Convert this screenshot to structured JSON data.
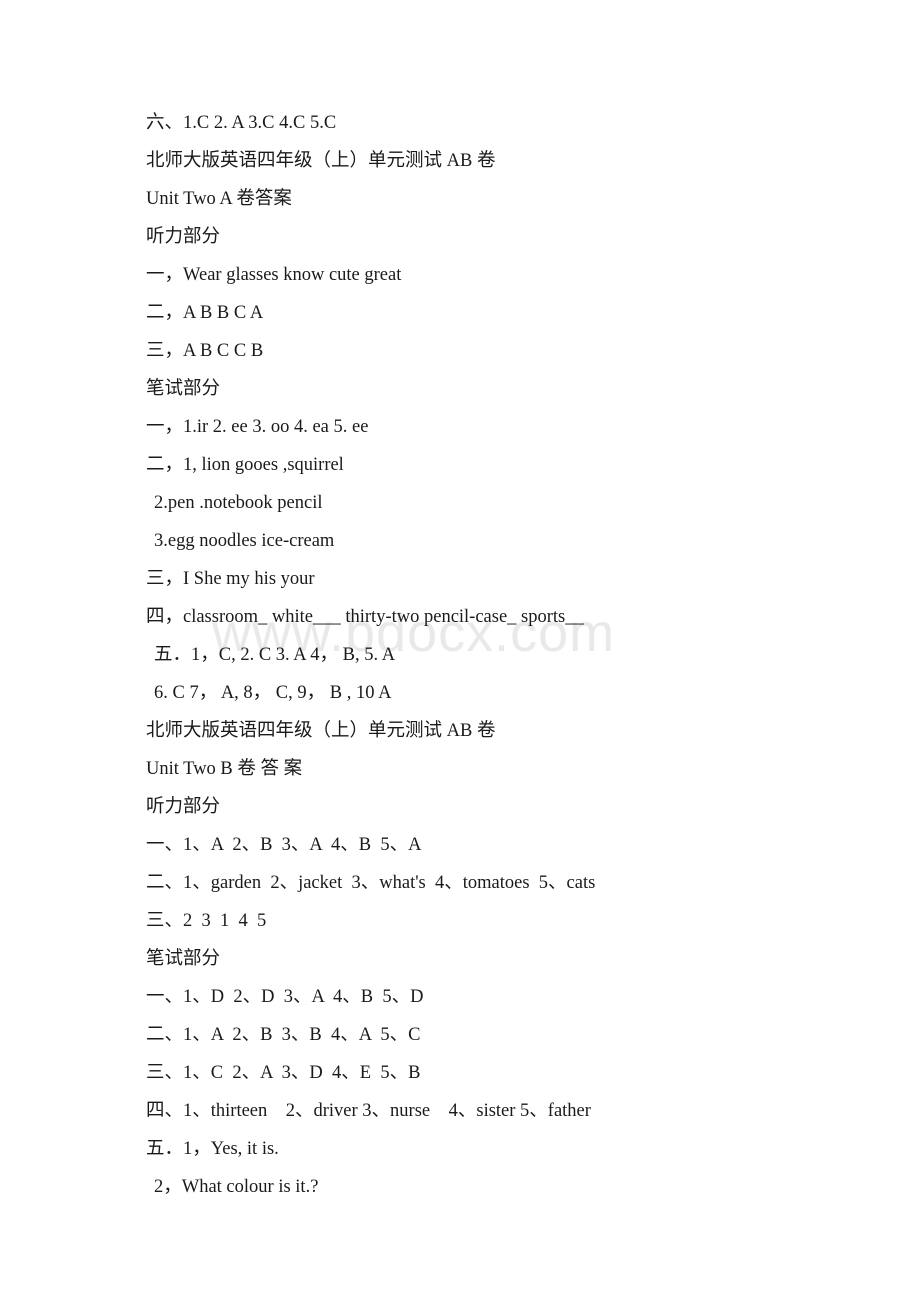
{
  "document": {
    "watermark": "www.bdocx.com",
    "lines": [
      {
        "id": "line-a-six",
        "text": "六、1.C 2. A 3.C 4.C 5.C",
        "indent": false
      },
      {
        "id": "line-a-header",
        "text": "北师大版英语四年级（上）单元测试 AB 卷",
        "indent": false
      },
      {
        "id": "line-a-title",
        "text": "Unit Two A 卷答案",
        "indent": false
      },
      {
        "id": "line-a-listening",
        "text": "听力部分",
        "indent": false
      },
      {
        "id": "line-a-listen-1",
        "text": "一，Wear glasses know cute great",
        "indent": false
      },
      {
        "id": "line-a-listen-2",
        "text": "二，A B B C A",
        "indent": false
      },
      {
        "id": "line-a-listen-3",
        "text": "三，A B C C B",
        "indent": false
      },
      {
        "id": "line-a-written",
        "text": "笔试部分",
        "indent": false
      },
      {
        "id": "line-a-write-1",
        "text": "一，1.ir 2. ee 3. oo 4. ea 5. ee",
        "indent": false
      },
      {
        "id": "line-a-write-2",
        "text": "二，1, lion gooes ,squirrel",
        "indent": false
      },
      {
        "id": "line-a-write-2b",
        "text": "2.pen .notebook pencil",
        "indent": true
      },
      {
        "id": "line-a-write-2c",
        "text": "3.egg noodles ice-cream",
        "indent": true
      },
      {
        "id": "line-a-write-3",
        "text": "三，I She my his your",
        "indent": false
      },
      {
        "id": "line-a-write-4",
        "text": "四，classroom_ white___ thirty-two pencil-case_ sports__",
        "indent": false
      },
      {
        "id": "line-a-write-5",
        "text": "五．1，C, 2. C 3. A 4， B, 5. A",
        "indent": true
      },
      {
        "id": "line-a-write-5b",
        "text": "6. C 7， A, 8， C, 9， B , 10 A",
        "indent": true
      },
      {
        "id": "line-b-header",
        "text": "北师大版英语四年级（上）单元测试 AB 卷",
        "indent": false
      },
      {
        "id": "line-b-title",
        "text": "Unit Two B 卷 答 案",
        "indent": false
      },
      {
        "id": "line-b-listening",
        "text": "听力部分",
        "indent": false
      },
      {
        "id": "line-b-listen-1",
        "text": "一、1、A  2、B  3、A  4、B  5、A",
        "indent": false
      },
      {
        "id": "line-b-listen-2",
        "text": "二、1、garden  2、jacket  3、what's  4、tomatoes  5、cats",
        "indent": false
      },
      {
        "id": "line-b-listen-3",
        "text": "三、2  3  1  4  5",
        "indent": false
      },
      {
        "id": "line-b-written",
        "text": "笔试部分",
        "indent": false
      },
      {
        "id": "line-b-write-1",
        "text": "一、1、D  2、D  3、A  4、B  5、D",
        "indent": false
      },
      {
        "id": "line-b-write-2",
        "text": "二、1、A  2、B  3、B  4、A  5、C",
        "indent": false
      },
      {
        "id": "line-b-write-3",
        "text": "三、1、C  2、A  3、D  4、E  5、B",
        "indent": false
      },
      {
        "id": "line-b-write-4",
        "text": "四、1、thirteen    2、driver 3、nurse    4、sister 5、father",
        "indent": false
      },
      {
        "id": "line-b-write-5",
        "text": "五．1，Yes, it is.",
        "indent": false
      },
      {
        "id": "line-b-write-5b",
        "text": "2，What colour is it.?",
        "indent": true
      }
    ]
  }
}
